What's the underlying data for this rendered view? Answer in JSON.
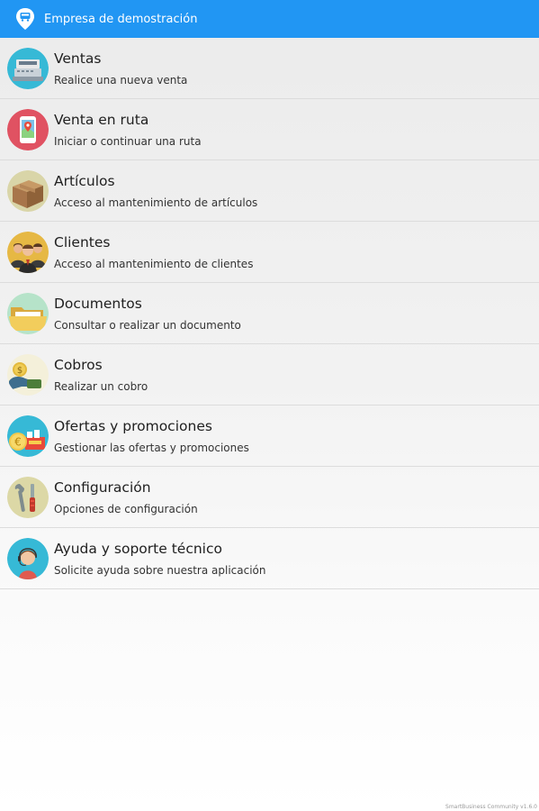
{
  "app": {
    "title": "Empresa de demostración"
  },
  "menu": {
    "items": [
      {
        "title": "Ventas",
        "subtitle": "Realice una nueva venta",
        "icon": "cash-register-icon",
        "bg": "#36b9d6"
      },
      {
        "title": "Venta en ruta",
        "subtitle": "Iniciar o continuar una ruta",
        "icon": "route-map-icon",
        "bg": "#e05262"
      },
      {
        "title": "Artículos",
        "subtitle": "Acceso al mantenimiento de artículos",
        "icon": "box-icon",
        "bg": "#d9d5a8"
      },
      {
        "title": "Clientes",
        "subtitle": "Acceso al mantenimiento de clientes",
        "icon": "customers-icon",
        "bg": "#e6b844"
      },
      {
        "title": "Documentos",
        "subtitle": "Consultar o realizar un documento",
        "icon": "folder-icon",
        "bg": "#b6e3c9"
      },
      {
        "title": "Cobros",
        "subtitle": "Realizar un cobro",
        "icon": "payment-icon",
        "bg": "#f4f0da"
      },
      {
        "title": "Ofertas y promociones",
        "subtitle": "Gestionar las ofertas y promociones",
        "icon": "offers-icon",
        "bg": "#36b9d6"
      },
      {
        "title": "Configuración",
        "subtitle": "Opciones de configuración",
        "icon": "tools-icon",
        "bg": "#dcd8a6"
      },
      {
        "title": "Ayuda y soporte técnico",
        "subtitle": "Solicite ayuda sobre nuestra aplicación",
        "icon": "support-agent-icon",
        "bg": "#36b9d6"
      }
    ]
  },
  "footer": {
    "version": "SmartBusiness Community v1.6.0"
  },
  "colors": {
    "appbar": "#2196f3",
    "divider": "#dcdcdc"
  }
}
